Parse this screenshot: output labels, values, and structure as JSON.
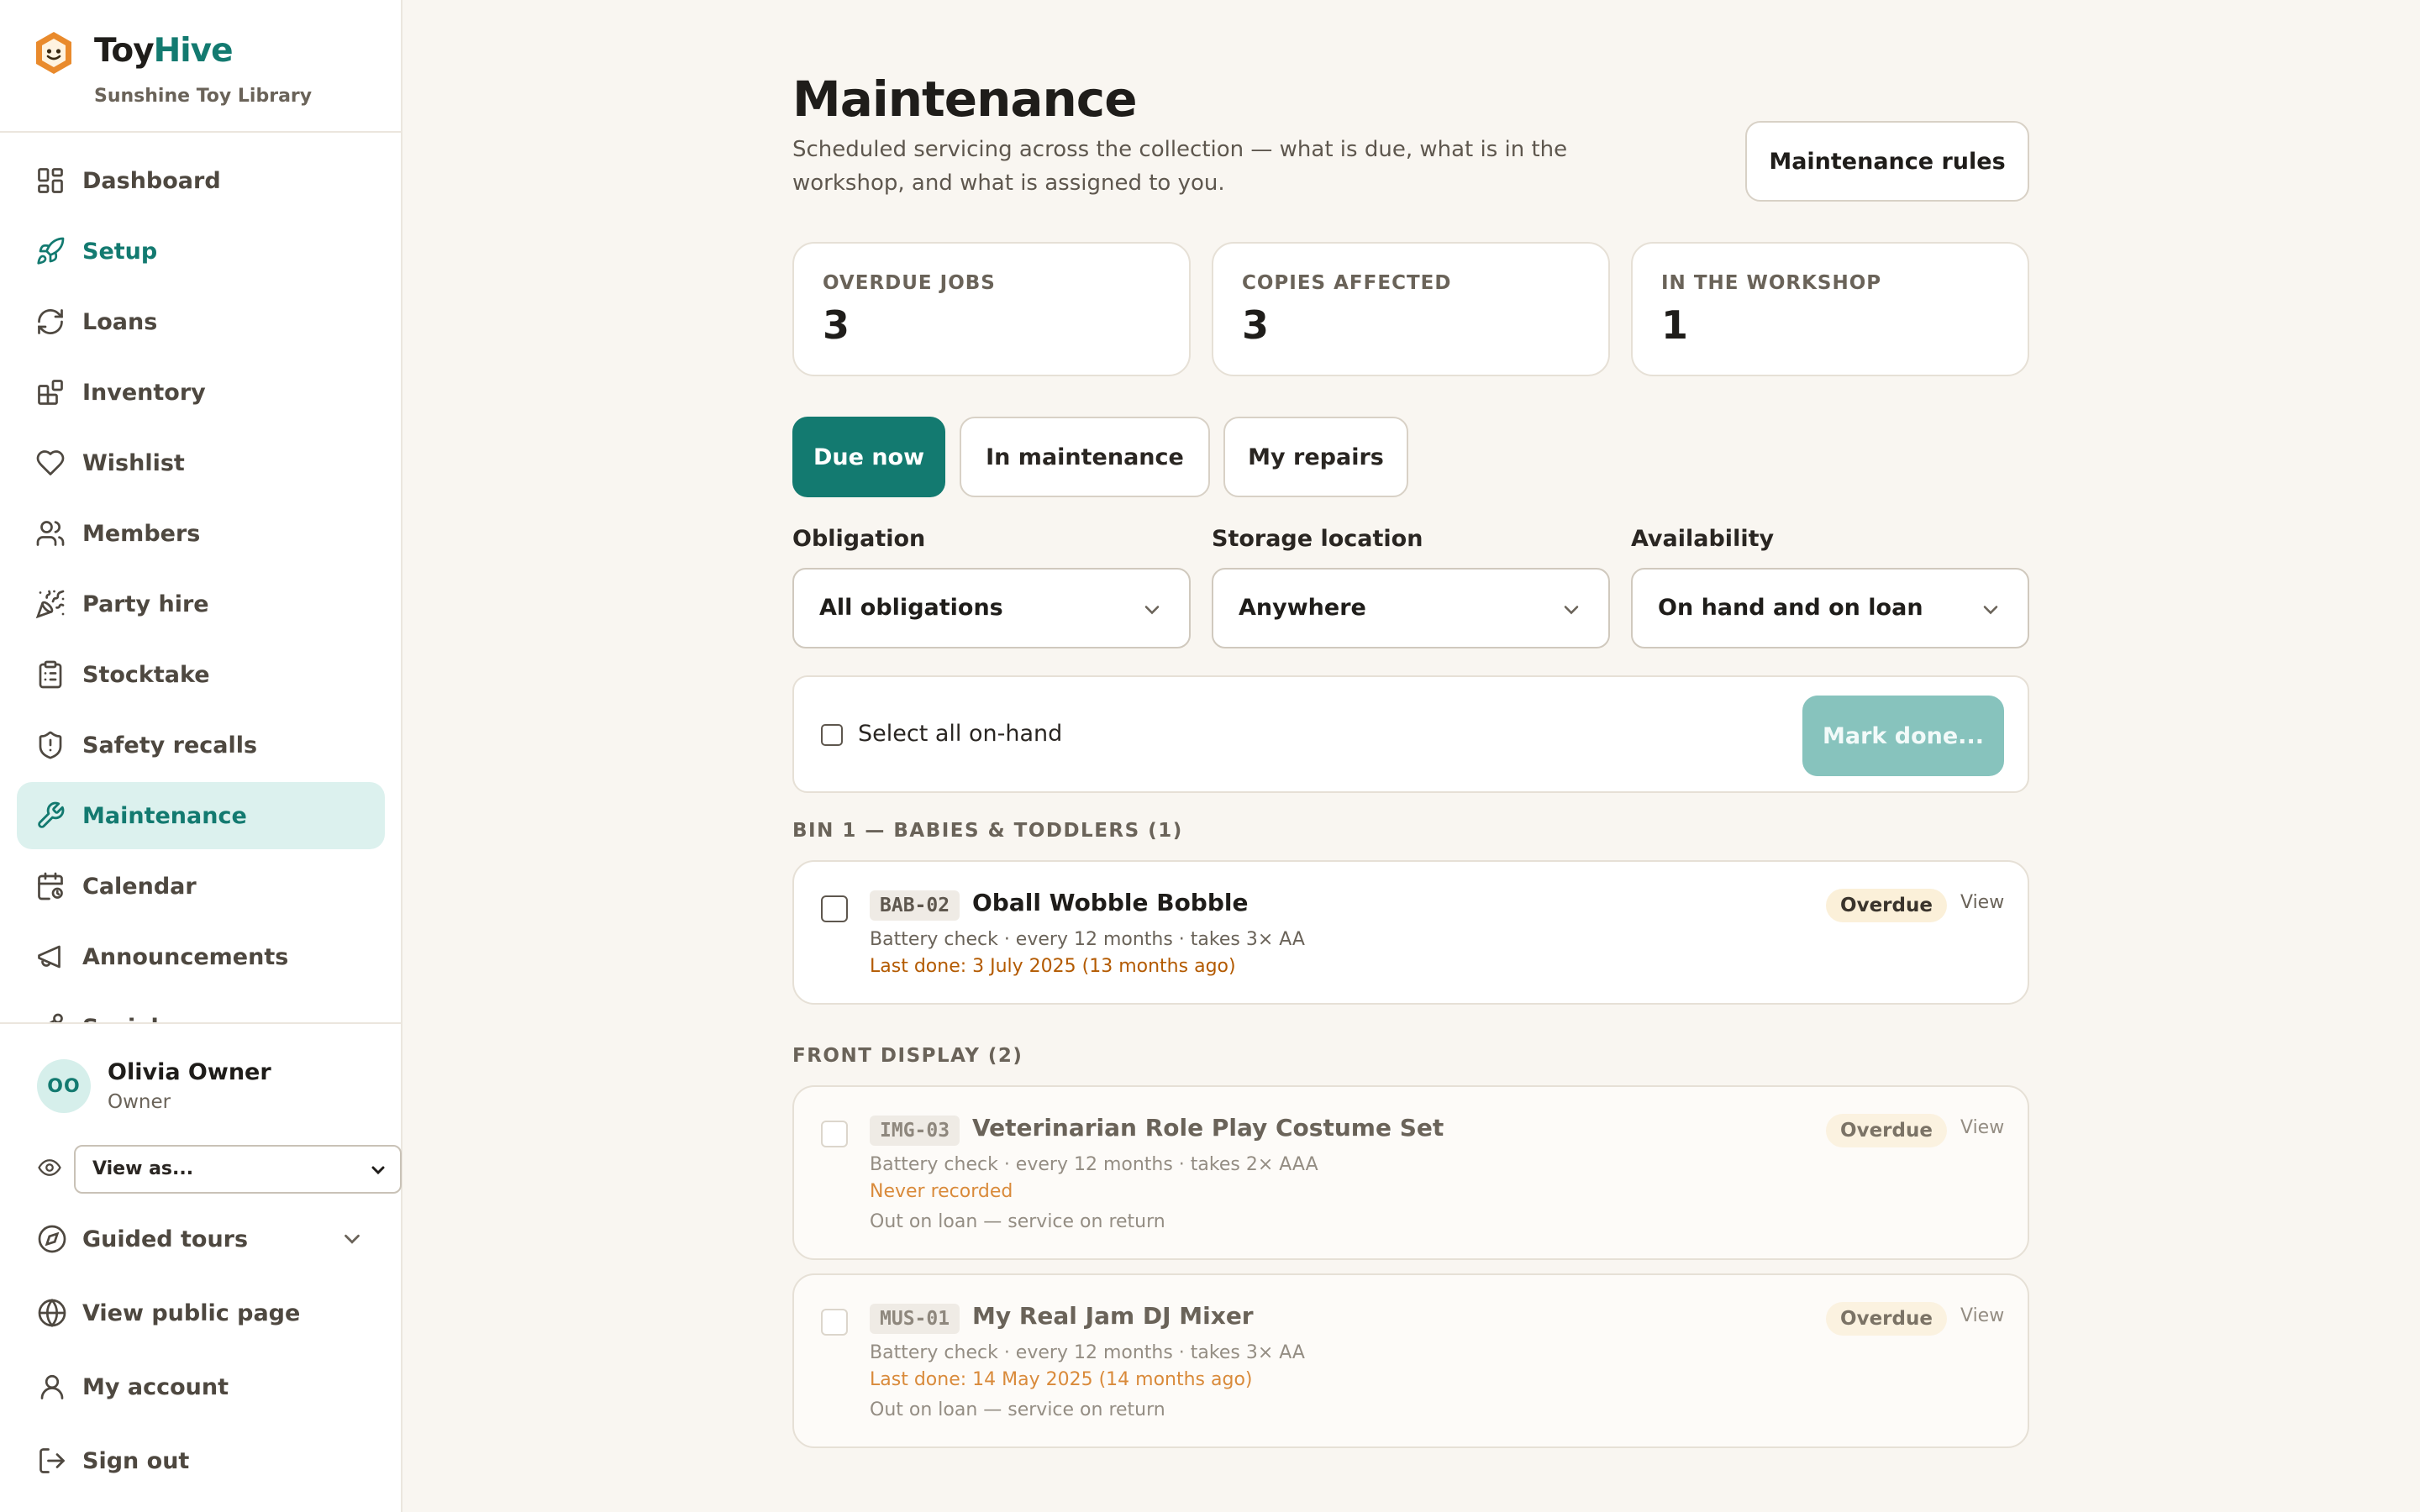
{
  "brand": {
    "name_part1": "Toy",
    "name_part2": "Hive",
    "subtitle": "Sunshine Toy Library"
  },
  "nav": [
    {
      "label": "Dashboard",
      "icon": "dashboard-icon"
    },
    {
      "label": "Setup",
      "icon": "rocket-icon"
    },
    {
      "label": "Loans",
      "icon": "refresh-icon"
    },
    {
      "label": "Inventory",
      "icon": "blocks-icon"
    },
    {
      "label": "Wishlist",
      "icon": "heart-icon"
    },
    {
      "label": "Members",
      "icon": "users-icon"
    },
    {
      "label": "Party hire",
      "icon": "party-popper-icon"
    },
    {
      "label": "Stocktake",
      "icon": "clipboard-icon"
    },
    {
      "label": "Safety recalls",
      "icon": "shield-icon"
    },
    {
      "label": "Maintenance",
      "icon": "wrench-icon"
    },
    {
      "label": "Calendar",
      "icon": "calendar-icon"
    },
    {
      "label": "Announcements",
      "icon": "megaphone-icon"
    },
    {
      "label": "Social",
      "icon": "share-icon"
    }
  ],
  "user": {
    "initials": "OO",
    "name": "Olivia Owner",
    "role": "Owner"
  },
  "view_as": {
    "selected": "View as..."
  },
  "bottom_nav": {
    "guided_tours": "Guided tours",
    "public_page": "View public page",
    "account": "My account",
    "sign_out": "Sign out"
  },
  "page": {
    "title": "Maintenance",
    "subtitle": "Scheduled servicing across the collection — what is due, what is in the workshop, and what is assigned to you.",
    "rules_button": "Maintenance rules"
  },
  "stats": [
    {
      "label": "OVERDUE JOBS",
      "value": "3"
    },
    {
      "label": "COPIES AFFECTED",
      "value": "3"
    },
    {
      "label": "IN THE WORKSHOP",
      "value": "1"
    }
  ],
  "tabs": [
    "Due now",
    "In maintenance",
    "My repairs"
  ],
  "filters": [
    {
      "label": "Obligation",
      "value": "All obligations"
    },
    {
      "label": "Storage location",
      "value": "Anywhere"
    },
    {
      "label": "Availability",
      "value": "On hand and on loan"
    }
  ],
  "bulk": {
    "select_all": "Select all on-hand",
    "mark_done": "Mark done..."
  },
  "groups": [
    {
      "heading": "BIN 1 — BABIES & TODDLERS (1)",
      "items": [
        {
          "code": "BAB-02",
          "name": "Oball Wobble Bobble",
          "meta": "Battery check · every 12 months · takes 3× AA",
          "last": "Last done: 3 July 2025 (13 months ago)",
          "status": "Overdue",
          "view": "View"
        }
      ]
    },
    {
      "heading": "FRONT DISPLAY (2)",
      "items": [
        {
          "code": "IMG-03",
          "name": "Veterinarian Role Play Costume Set",
          "meta": "Battery check · every 12 months · takes 2× AAA",
          "last": "Never recorded",
          "loan": "Out on loan — service on return",
          "status": "Overdue",
          "view": "View"
        },
        {
          "code": "MUS-01",
          "name": "My Real Jam DJ Mixer",
          "meta": "Battery check · every 12 months · takes 3× AA",
          "last": "Last done: 14 May 2025 (14 months ago)",
          "loan": "Out on loan — service on return",
          "status": "Overdue",
          "view": "View"
        }
      ]
    }
  ],
  "colors": {
    "accent": "#137a70",
    "accent_light": "#dcf1ee",
    "overdue_text": "#b35a00",
    "badge_bg": "#fbf0d9",
    "background": "#f9f6f1"
  }
}
